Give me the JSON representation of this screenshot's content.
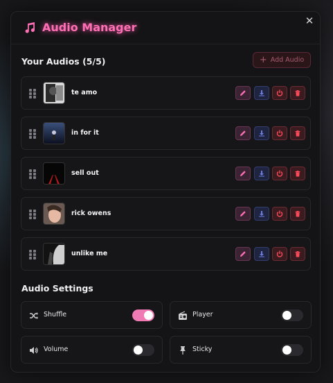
{
  "header": {
    "title": "Audio Manager",
    "title_icon": "music-note-icon",
    "close_label": "✕"
  },
  "audios": {
    "section_title": "Your Audios (5/5)",
    "add_label": "Add Audio",
    "items": [
      {
        "name": "te amo"
      },
      {
        "name": "in for it"
      },
      {
        "name": "sell out"
      },
      {
        "name": "rick owens"
      },
      {
        "name": "unlike me"
      }
    ]
  },
  "settings": {
    "section_title": "Audio Settings",
    "items": [
      {
        "label": "Shuffle",
        "icon": "shuffle-icon",
        "enabled": true
      },
      {
        "label": "Player",
        "icon": "radio-icon",
        "enabled": false
      },
      {
        "label": "Volume",
        "icon": "volume-icon",
        "enabled": false
      },
      {
        "label": "Sticky",
        "icon": "pin-icon",
        "enabled": false
      }
    ]
  },
  "colors": {
    "accent": "#ff6fb5",
    "edit": "#ff6fb5",
    "download": "#6f7fe0",
    "danger": "#ff4a5a"
  }
}
